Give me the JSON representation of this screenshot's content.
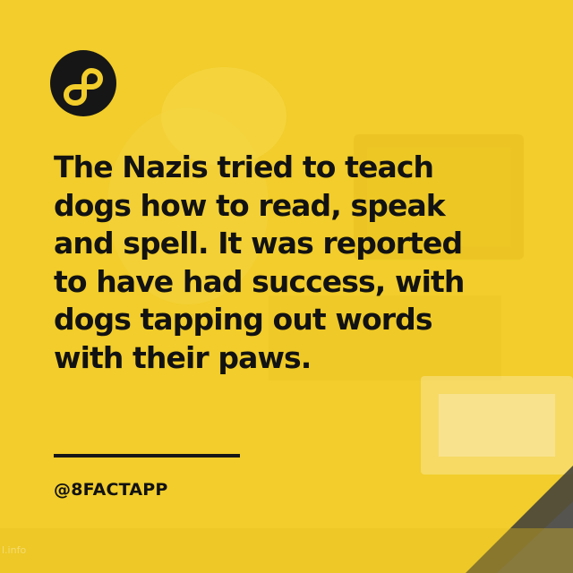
{
  "brand": {
    "logo_icon": "infinity-eight-icon",
    "handle": "@8FACTAPP"
  },
  "fact": {
    "text": "The Nazis tried to teach\ndogs how to read, speak\nand spell. It was reported\nto have had success, with\ndogs tapping out words\nwith their paws."
  },
  "watermark": {
    "text": "l.info"
  },
  "colors": {
    "background": "#f2cd2b",
    "text": "#121212",
    "logo_circle": "#161616"
  }
}
